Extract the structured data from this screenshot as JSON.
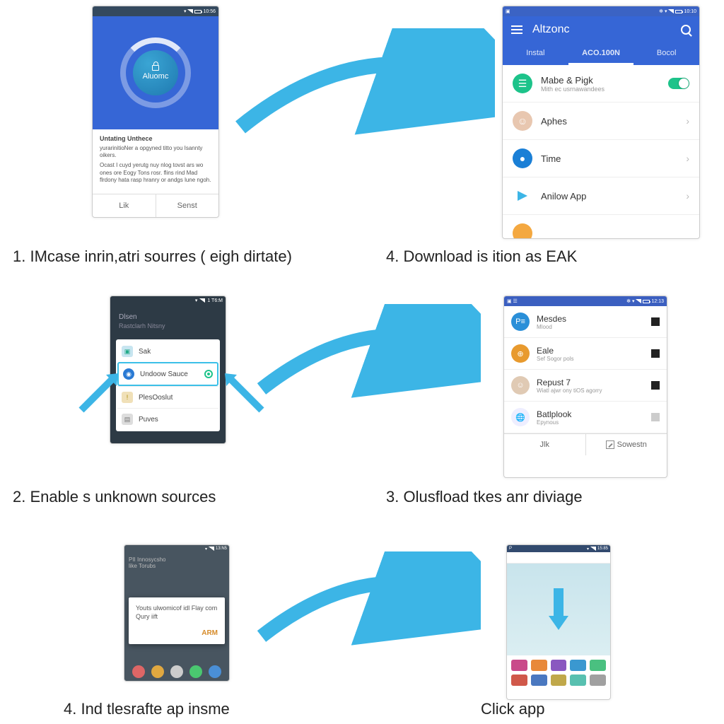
{
  "phoneA": {
    "status_time": "10:56",
    "dial_label": "Aluomc",
    "card_title": "Untating Unthece",
    "card_line1": "yurarinitioNer a opgyned titto you Isannty oikers.",
    "card_line2": "Ocast I cuyd yerutg nuy nlog tovst ars wo ones ore Eogy Tons rosr. flins rind Mad flrdony hata rasp hranry or andgs lune ngoh.",
    "btn_left": "Lik",
    "btn_right": "Senst"
  },
  "caption1": "1.  IMcase inrin,atri sourres ( eigh dirtate)",
  "phoneB": {
    "status_time": "10:10",
    "app_name": "Altzonc",
    "tab1": "Instal",
    "tab2": "ACO.100N",
    "tab3": "Bocol",
    "row1_title": "Mabe & Pigk",
    "row1_sub": "Mith ec usrnawandees",
    "row2_title": "Aphes",
    "row3_title": "Time",
    "row4_title": "Anilow App"
  },
  "caption4": "4.  Download is ition as EAK",
  "phoneC": {
    "status_time": "1 T6:M",
    "header": "Dlsen",
    "subheader": "Rastclarh Nitsny",
    "opt1": "Sak",
    "opt2": "Undoow Sauce",
    "opt3": "PlesOoslut",
    "opt4": "Puves"
  },
  "caption2": "2.  Enable s unknown sources",
  "phoneD": {
    "status_time": "12:13",
    "r1_t": "Mesdes",
    "r1_s": "Mlood",
    "r2_t": "Eale",
    "r2_s": "Sef Sogor pols",
    "r3_t": "Repust 7",
    "r3_s": "Wiatl ajwr ony tiOS agorry",
    "r4_t": "Batlplook",
    "r4_s": "Epynous",
    "btn_left": "Jlk",
    "btn_right": "Sowestn"
  },
  "caption3": "3.  Olusfload tkes anr diviage",
  "phoneE": {
    "status_time": "13:N5",
    "top1": "PII Innosycsho",
    "top2": "like Torubs",
    "modal_text": "Youts ulwomicof idl Flay com Qury iift",
    "modal_btn": "ARM"
  },
  "caption5": "4.  Ind tlesrafte ap insme",
  "phoneF": {
    "status_time": "15:85"
  },
  "caption6": "Click app"
}
